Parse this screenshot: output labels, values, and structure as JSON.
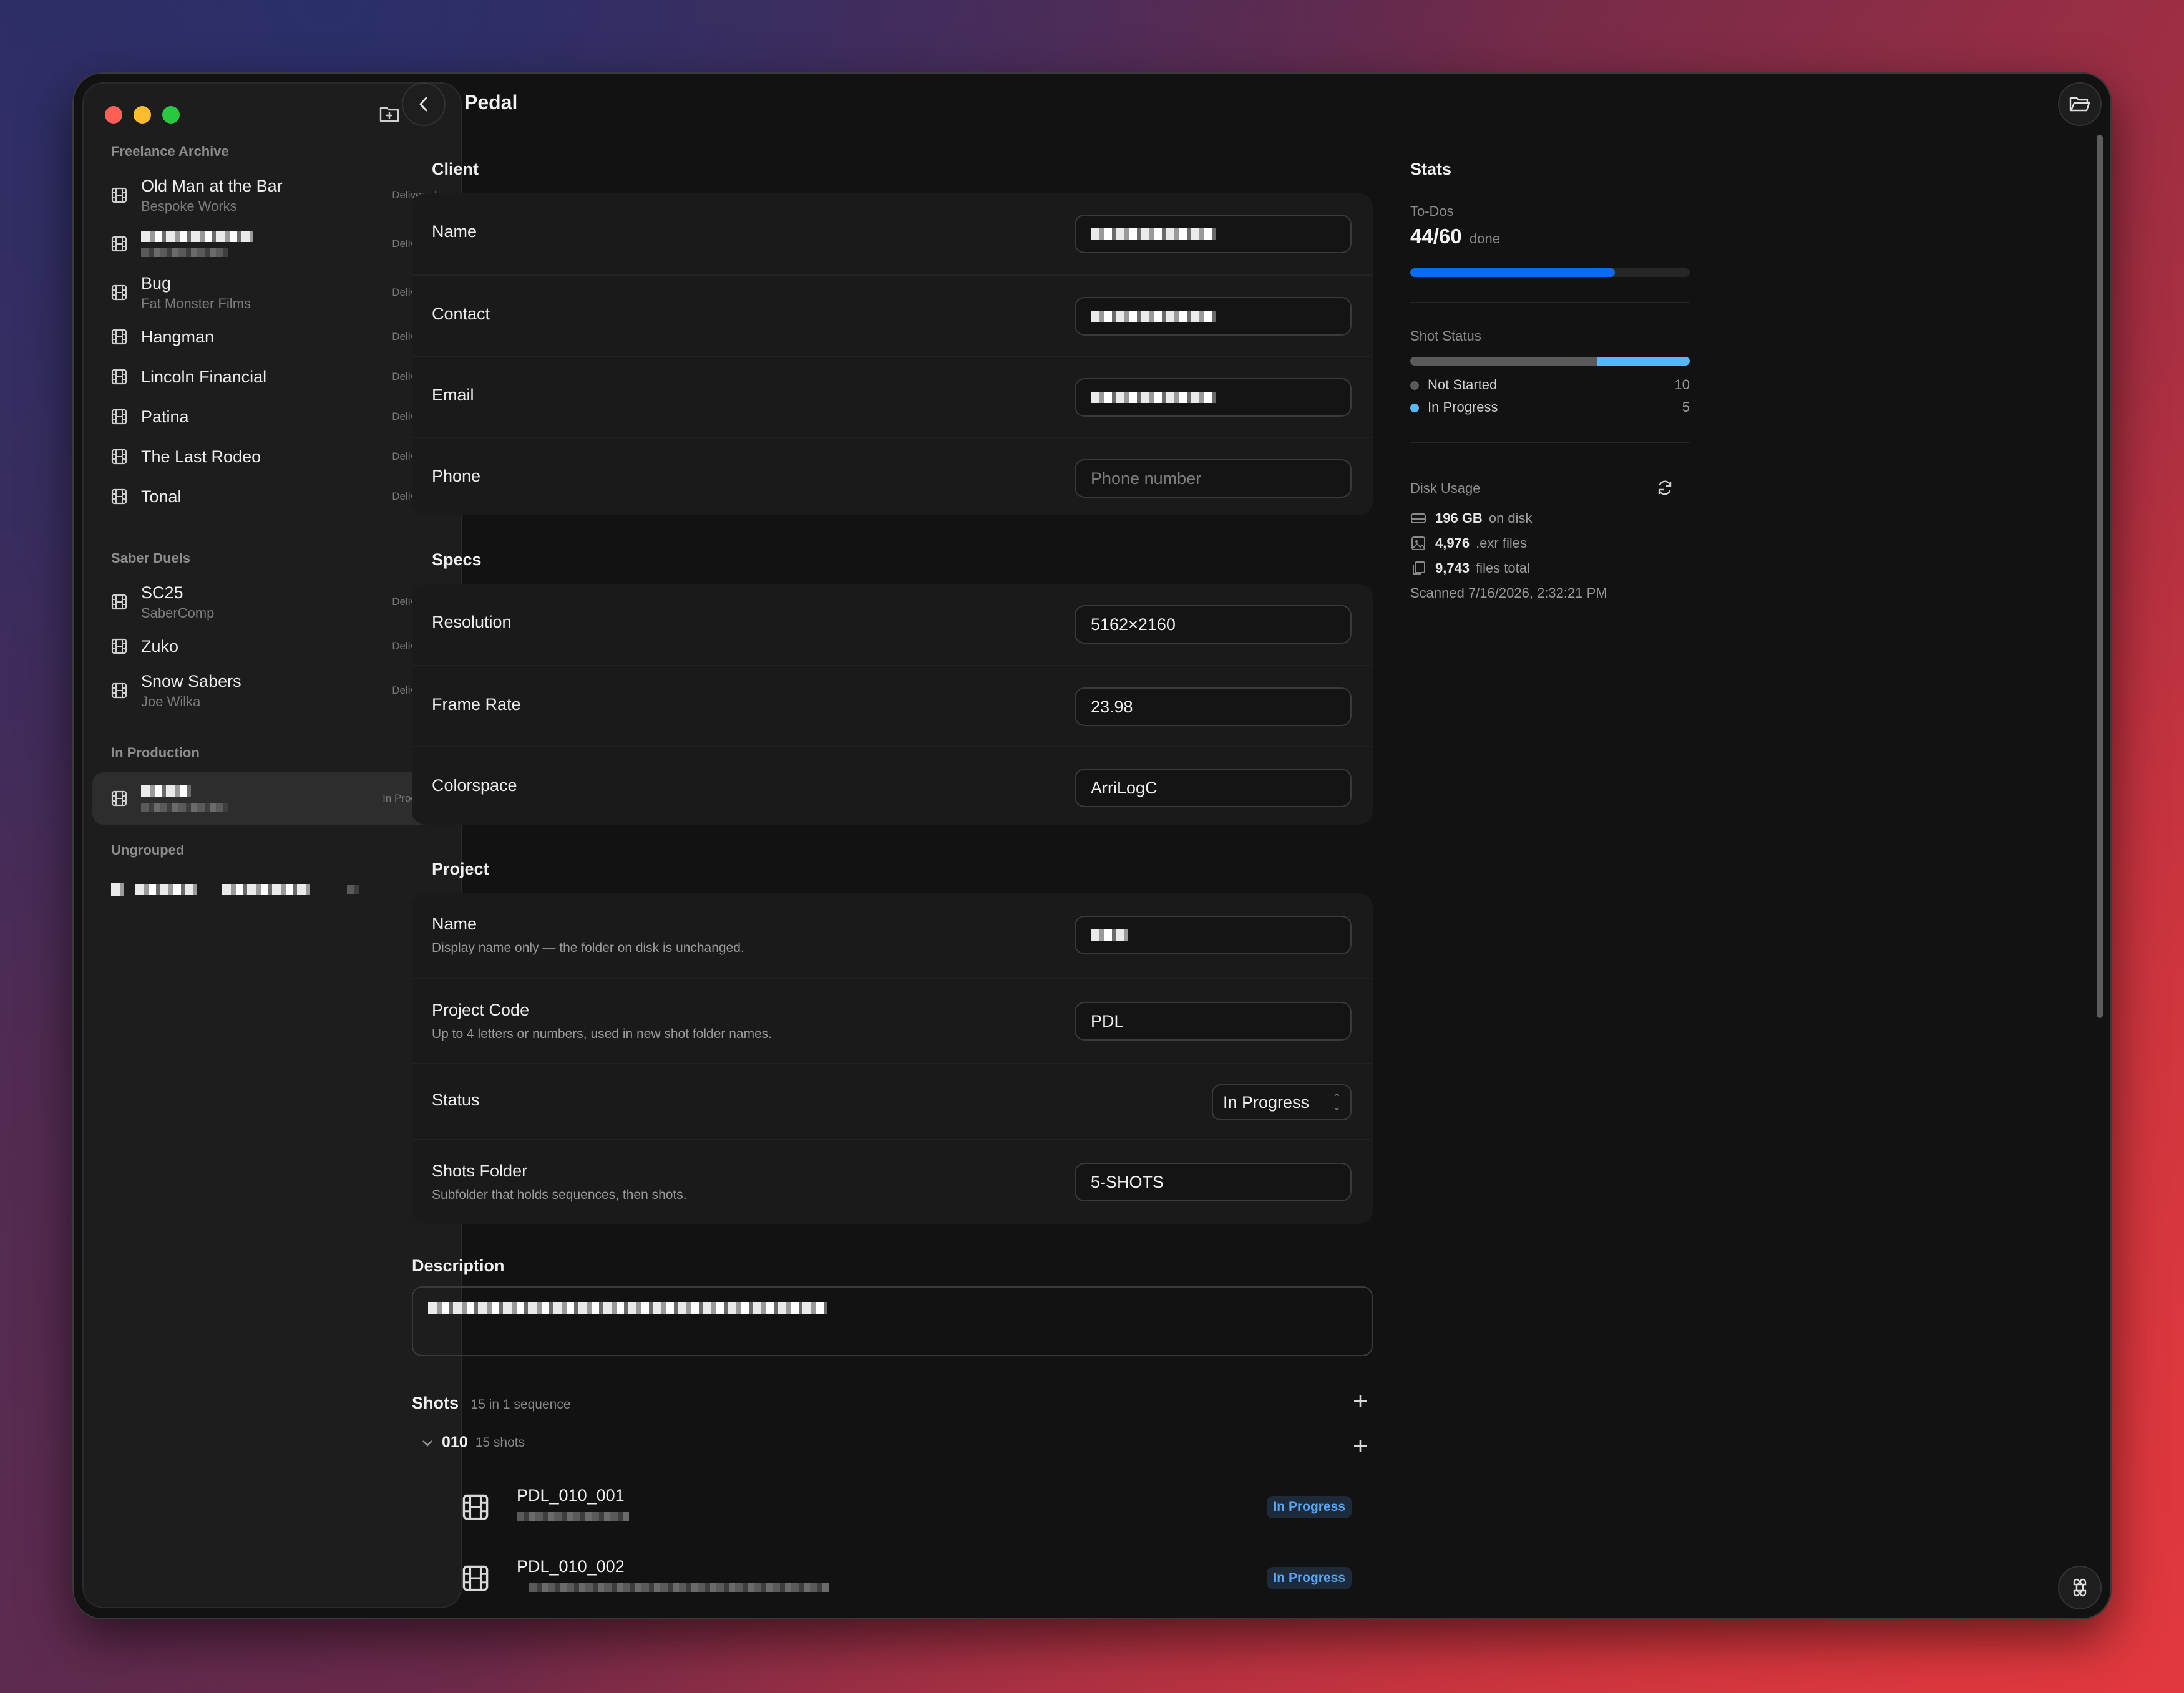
{
  "window": {
    "title": "Pedal"
  },
  "sidebar": {
    "groups": [
      {
        "label": "Freelance Archive",
        "items": [
          {
            "title": "Old Man at the Bar",
            "subtitle": "Bespoke Works",
            "badge": "Delivered"
          },
          {
            "title": "",
            "subtitle": "",
            "badge": "Delivered"
          },
          {
            "title": "Bug",
            "subtitle": "Fat Monster Films",
            "badge": "Delivered"
          },
          {
            "title": "Hangman",
            "subtitle": "",
            "badge": "Delivered"
          },
          {
            "title": "Lincoln Financial",
            "subtitle": "",
            "badge": "Delivered"
          },
          {
            "title": "Patina",
            "subtitle": "",
            "badge": "Delivered"
          },
          {
            "title": "The Last Rodeo",
            "subtitle": "",
            "badge": "Delivered"
          },
          {
            "title": "Tonal",
            "subtitle": "",
            "badge": "Delivered"
          }
        ]
      },
      {
        "label": "Saber Duels",
        "items": [
          {
            "title": "SC25",
            "subtitle": "SaberComp",
            "badge": "Delivered"
          },
          {
            "title": "Zuko",
            "subtitle": "",
            "badge": "Delivered"
          },
          {
            "title": "Snow Sabers",
            "subtitle": "Joe Wilka",
            "badge": "Delivered"
          }
        ]
      },
      {
        "label": "In Production",
        "items": [
          {
            "title": "",
            "subtitle": "",
            "badge": "In Progress"
          }
        ]
      },
      {
        "label": "Ungrouped",
        "items": []
      }
    ]
  },
  "client": {
    "section": "Client",
    "name_label": "Name",
    "name_value": "",
    "contact_label": "Contact",
    "contact_value": "",
    "email_label": "Email",
    "email_value": "",
    "phone_label": "Phone",
    "phone_placeholder": "Phone number"
  },
  "specs": {
    "section": "Specs",
    "resolution_label": "Resolution",
    "resolution_value": "5162×2160",
    "framerate_label": "Frame Rate",
    "framerate_value": "23.98",
    "colorspace_label": "Colorspace",
    "colorspace_value": "ArriLogC"
  },
  "project": {
    "section": "Project",
    "name_label": "Name",
    "name_help": "Display name only — the folder on disk is unchanged.",
    "name_value": "",
    "code_label": "Project Code",
    "code_help": "Up to 4 letters or numbers, used in new shot folder names.",
    "code_value": "PDL",
    "status_label": "Status",
    "status_value": "In Progress",
    "shots_folder_label": "Shots Folder",
    "shots_folder_help": "Subfolder that holds sequences, then shots.",
    "shots_folder_value": "5-SHOTS"
  },
  "description": {
    "label": "Description",
    "value": ""
  },
  "shots": {
    "label": "Shots",
    "summary": "15 in 1 sequence",
    "sequence": {
      "name": "010",
      "count": "15 shots"
    },
    "items": [
      {
        "name": "PDL_010_001",
        "status": "In Progress"
      },
      {
        "name": "PDL_010_002",
        "status": "In Progress"
      }
    ]
  },
  "stats": {
    "title": "Stats",
    "todos_label": "To-Dos",
    "todos_value": "44/60",
    "todos_suffix": "done",
    "todos_fraction": 0.733,
    "shot_status_label": "Shot Status",
    "shot_status": [
      {
        "label": "Not Started",
        "count": "10",
        "color": "#5a5a5a",
        "fraction": 0.667
      },
      {
        "label": "In Progress",
        "count": "5",
        "color": "#58b8f5",
        "fraction": 0.333
      }
    ],
    "disk_label": "Disk Usage",
    "disk_size": "196 GB",
    "disk_size_suffix": "on disk",
    "exr_count": "4,976",
    "exr_suffix": ".exr files",
    "files_total": "9,743",
    "files_suffix": "files total",
    "scanned": "Scanned 7/16/2026, 2:32:21 PM"
  },
  "colors": {
    "accent": "#0a6cf0",
    "in_progress": "#58b8f5",
    "not_started": "#5a5a5a"
  },
  "icons": [
    "film-icon",
    "new-folder-icon",
    "plus-icon",
    "chevron-left-icon",
    "folder-open-icon",
    "refresh-icon",
    "drive-icon",
    "image-icon",
    "files-icon",
    "chevron-down-icon",
    "command-icon"
  ]
}
